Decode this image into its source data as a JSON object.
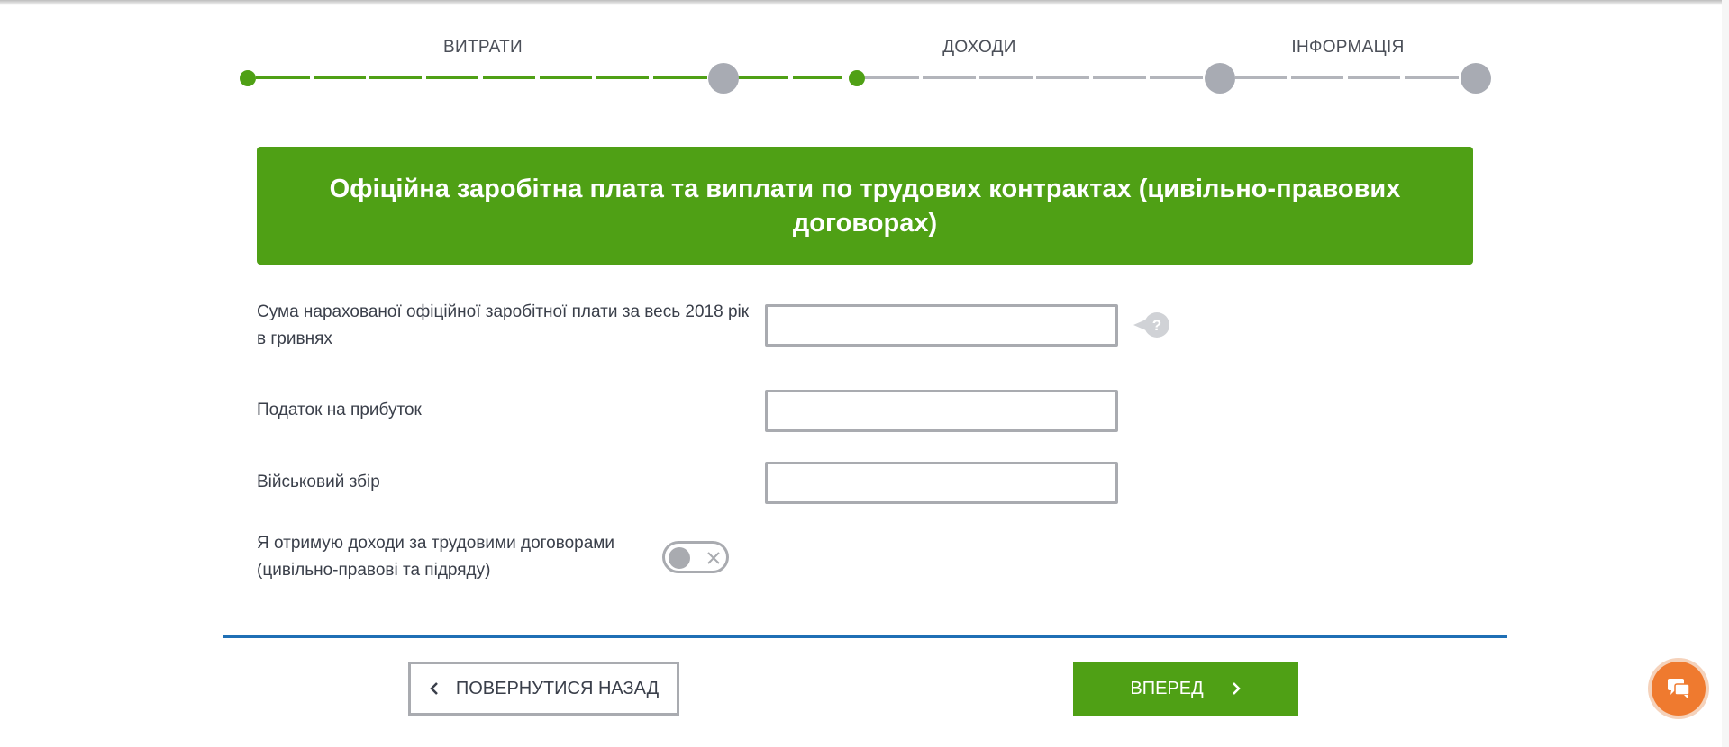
{
  "stepper": {
    "labels": [
      "ВИТРАТИ",
      "ДОХОДИ",
      "ІНФОРМАЦІЯ"
    ],
    "colors": {
      "active": "#4fa015",
      "inactive": "#a8abb3"
    }
  },
  "banner": {
    "title": "Офіційна заробітна плата та виплати по трудових контрактах (цивільно-правових договорах)",
    "color": "#4fa015"
  },
  "form": {
    "salary": {
      "label": "Сума нарахованої офіційної заробітної плати за весь 2018 рік в гривнях",
      "value": ""
    },
    "income_tax": {
      "label": "Податок на прибуток",
      "value": ""
    },
    "military_levy": {
      "label": "Військовий збір",
      "value": ""
    },
    "contracts_toggle": {
      "label": "Я отримую доходи за трудовими договорами (цивільно-правові та підряду)",
      "state": "off"
    },
    "help_icon": "question-bubble-icon"
  },
  "nav": {
    "back_label": "ПОВЕРНУТИСЯ НАЗАД",
    "next_label": "ВПЕРЕД",
    "divider_color": "#1f6fb5"
  },
  "chat": {
    "icon": "chat-icon",
    "color": "#ef7a2f"
  }
}
